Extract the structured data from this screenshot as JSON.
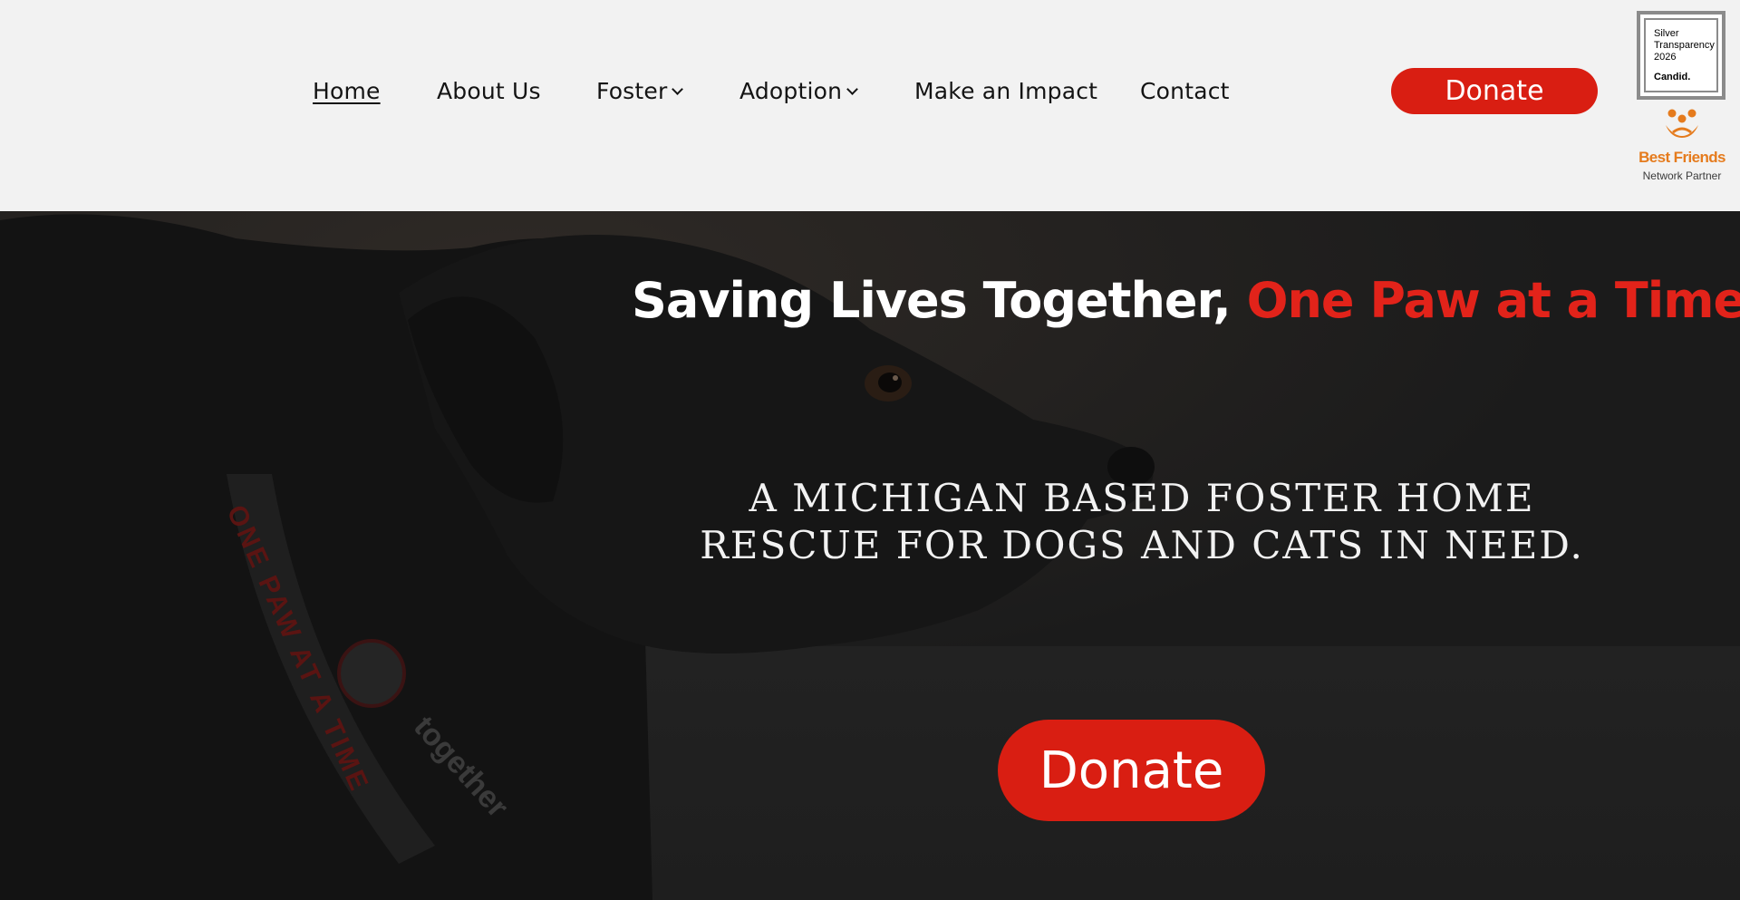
{
  "nav": {
    "items": [
      {
        "label": "Home",
        "active": true,
        "dropdown": false
      },
      {
        "label": "About Us",
        "dropdown": false
      },
      {
        "label": "Foster",
        "dropdown": true
      },
      {
        "label": "Adoption",
        "dropdown": true
      },
      {
        "label": "Make an Impact",
        "dropdown": false
      },
      {
        "label": "Contact",
        "dropdown": false
      }
    ],
    "donate_label": "Donate"
  },
  "badges": {
    "candid": {
      "line1": "Silver",
      "line2": "Transparency",
      "line3": "2026",
      "brand": "Candid."
    },
    "best_friends": {
      "name": "Best Friends",
      "subtitle": "Network Partner"
    }
  },
  "hero": {
    "headline_white": "Saving Lives Together,",
    "headline_red": "One Paw at a Time.",
    "subtitle_line1": "A Michigan based foster home",
    "subtitle_line2": "rescue for dogs and cats in need.",
    "donate_label": "Donate"
  },
  "colors": {
    "accent_red": "#d91e12",
    "header_bg": "#f2f2f2",
    "hero_bg": "#1c1c1c",
    "best_friends_orange": "#e57b1d"
  }
}
